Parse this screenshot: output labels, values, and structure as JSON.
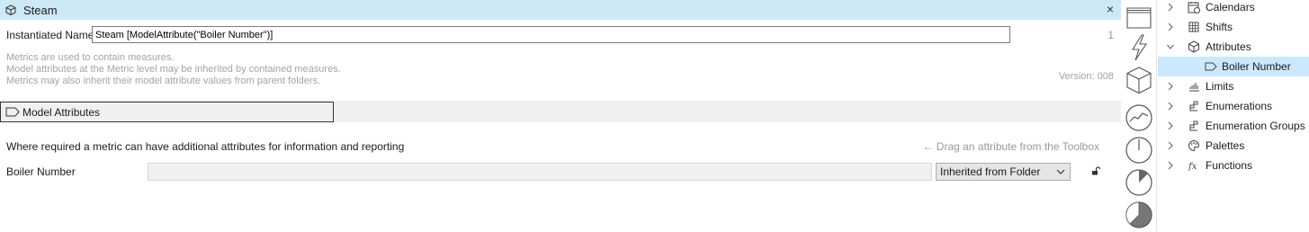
{
  "header": {
    "title": "Steam",
    "close_label": "×"
  },
  "instantiated": {
    "label": "Instantiated Name",
    "value": "Steam [ModelAttribute(\"Boiler Number\")]",
    "counter": "1"
  },
  "description": {
    "line1": "Metrics are used to contain measures.",
    "line2": "Model attributes at the Metric level may be inherited by contained measures.",
    "line3": "Metrics may also inherit their model attribute values from parent folders.",
    "version": "Version: 008"
  },
  "section": {
    "title": "Model Attributes"
  },
  "attributes": {
    "required_text": "Where required a metric can have additional attributes for information and reporting",
    "drag_hint": "← Drag an attribute from the Toolbox",
    "row": {
      "label": "Boiler Number",
      "value": "",
      "source": "Inherited from Folder"
    }
  },
  "toolbox": {
    "icons": [
      "folder-icon",
      "lightning-icon",
      "cube-icon",
      "trend-icon",
      "clock-icon",
      "pie-small-icon",
      "pie-large-icon"
    ]
  },
  "tree": {
    "items": [
      {
        "label": "Calendars",
        "icon": "calendar-icon",
        "expanded": false
      },
      {
        "label": "Shifts",
        "icon": "grid-icon",
        "expanded": false
      },
      {
        "label": "Attributes",
        "icon": "cube-icon",
        "expanded": true
      },
      {
        "label": "Boiler Number",
        "icon": "tag-icon",
        "selected": true
      },
      {
        "label": "Limits",
        "icon": "limits-icon",
        "expanded": false
      },
      {
        "label": "Enumerations",
        "icon": "enum-icon",
        "expanded": false
      },
      {
        "label": "Enumeration Groups",
        "icon": "enum-icon",
        "expanded": false
      },
      {
        "label": "Palettes",
        "icon": "palette-icon",
        "expanded": false
      },
      {
        "label": "Functions",
        "icon": "fx-icon",
        "expanded": false
      }
    ]
  },
  "colors": {
    "header_bg": "#cde8f7",
    "selected_bg": "#cce8ff",
    "muted_text": "#a3a3a3"
  }
}
